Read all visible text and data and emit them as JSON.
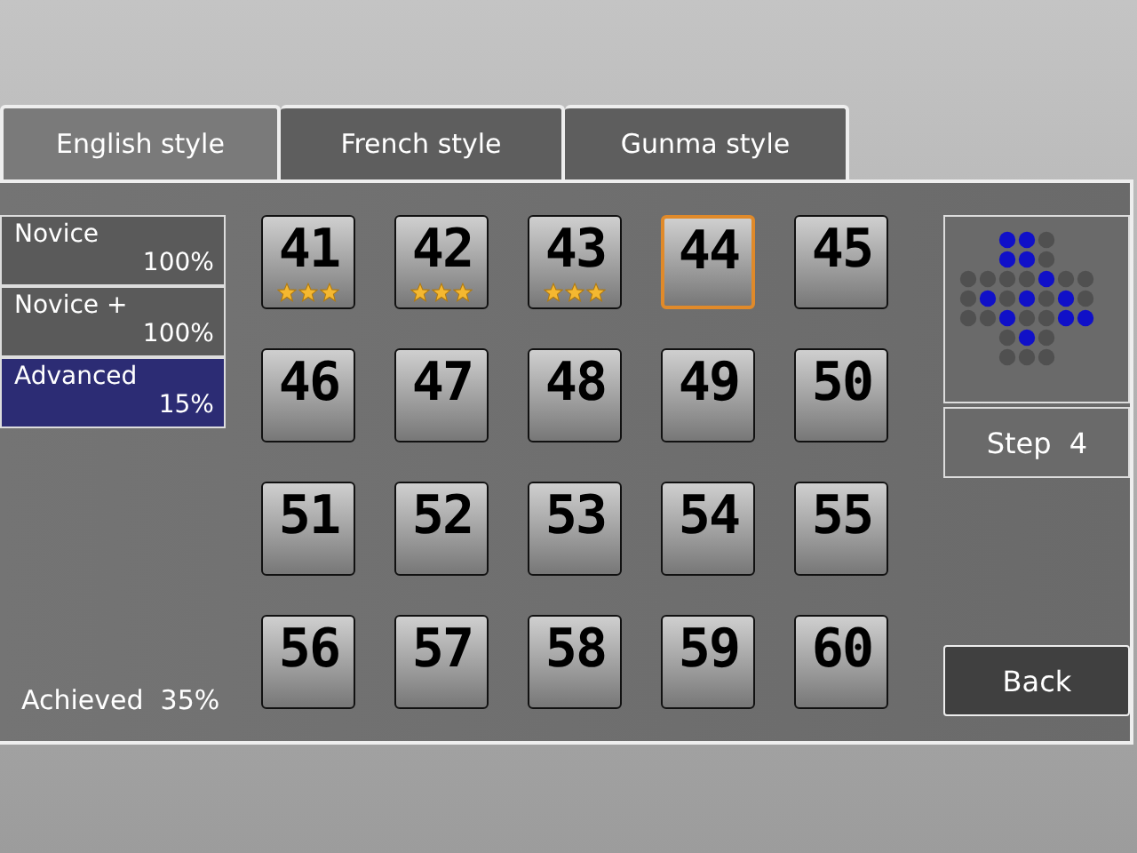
{
  "tabs": [
    {
      "label": "English style",
      "selected": true
    },
    {
      "label": "French style",
      "selected": false
    },
    {
      "label": "Gunma style",
      "selected": false
    }
  ],
  "categories": [
    {
      "name": "Novice",
      "percent": "100%",
      "selected": false
    },
    {
      "name": "Novice +",
      "percent": "100%",
      "selected": false
    },
    {
      "name": "Advanced",
      "percent": "15%",
      "selected": true
    }
  ],
  "achieved": {
    "label": "Achieved",
    "value": "35%"
  },
  "levels": [
    {
      "number": "41",
      "stars": 3,
      "selected": false
    },
    {
      "number": "42",
      "stars": 3,
      "selected": false
    },
    {
      "number": "43",
      "stars": 3,
      "selected": false
    },
    {
      "number": "44",
      "selected": true
    },
    {
      "number": "45",
      "selected": false
    },
    {
      "number": "46",
      "selected": false
    },
    {
      "number": "47",
      "selected": false
    },
    {
      "number": "48",
      "selected": false
    },
    {
      "number": "49",
      "selected": false
    },
    {
      "number": "50",
      "selected": false
    },
    {
      "number": "51",
      "selected": false
    },
    {
      "number": "52",
      "selected": false
    },
    {
      "number": "53",
      "selected": false
    },
    {
      "number": "54",
      "selected": false
    },
    {
      "number": "55",
      "selected": false
    },
    {
      "number": "56",
      "selected": false
    },
    {
      "number": "57",
      "selected": false
    },
    {
      "number": "58",
      "selected": false
    },
    {
      "number": "59",
      "selected": false
    },
    {
      "number": "60",
      "selected": false
    }
  ],
  "step": "Step  4",
  "back_button": "Back"
}
